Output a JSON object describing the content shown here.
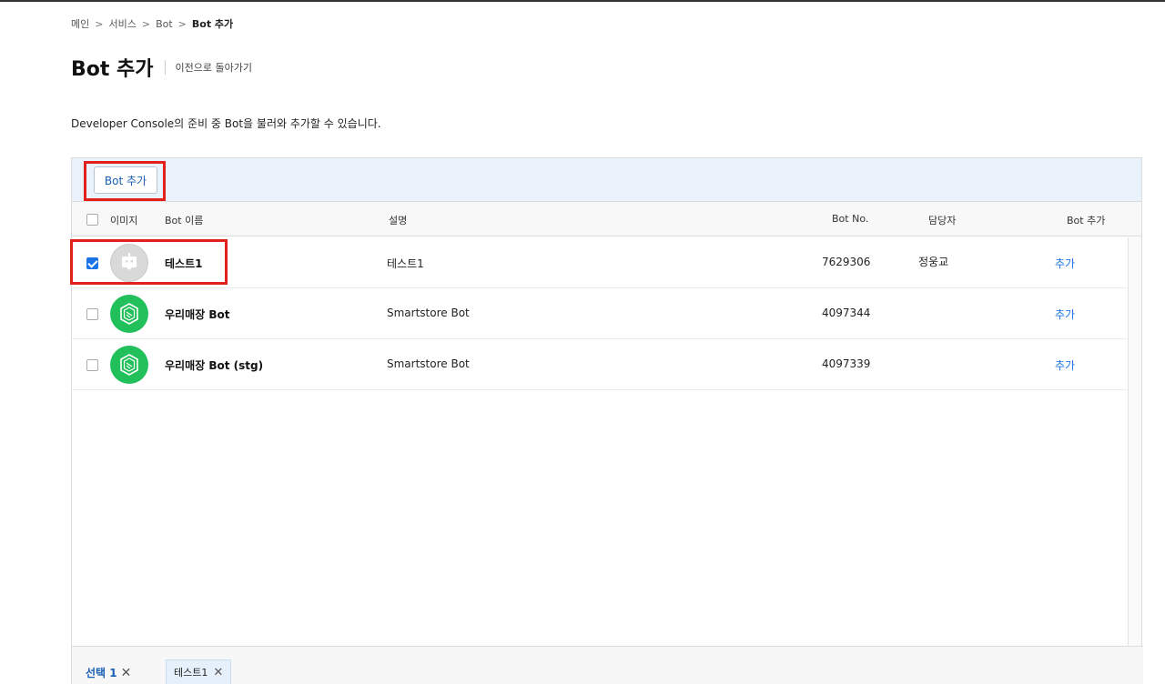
{
  "breadcrumb": {
    "items": [
      "메인",
      "서비스",
      "Bot"
    ],
    "current": "Bot 추가",
    "separator": ">"
  },
  "header": {
    "title": "Bot 추가",
    "back_link": "이전으로 돌아가기"
  },
  "description": "Developer Console의 준비 중 Bot을 불러와 추가할 수 있습니다.",
  "toolbar": {
    "add_button_label": "Bot 추가"
  },
  "table": {
    "columns": {
      "image": "이미지",
      "name": "Bot 이름",
      "description": "설명",
      "bot_no": "Bot No.",
      "owner": "담당자",
      "add": "Bot 추가"
    },
    "rows": [
      {
        "name": "테스트1",
        "description": "테스트1",
        "bot_no": "7629306",
        "owner": "정웅교",
        "action": "추가",
        "checked": true,
        "avatar": "robot-icon"
      },
      {
        "name": "우리매장 Bot",
        "description": "Smartstore Bot",
        "bot_no": "4097344",
        "owner": "",
        "action": "추가",
        "checked": false,
        "avatar": "smartstore-icon"
      },
      {
        "name": "우리매장 Bot (stg)",
        "description": "Smartstore Bot",
        "bot_no": "4097339",
        "owner": "",
        "action": "추가",
        "checked": false,
        "avatar": "smartstore-icon"
      }
    ]
  },
  "footer": {
    "selection_label": "선택 1",
    "selected_chip": "테스트1"
  },
  "colors": {
    "accent": "#1a73e8",
    "highlight": "#e3201b",
    "toolbar_bg": "#eaf3fc",
    "avatar_green": "#21c05a"
  }
}
